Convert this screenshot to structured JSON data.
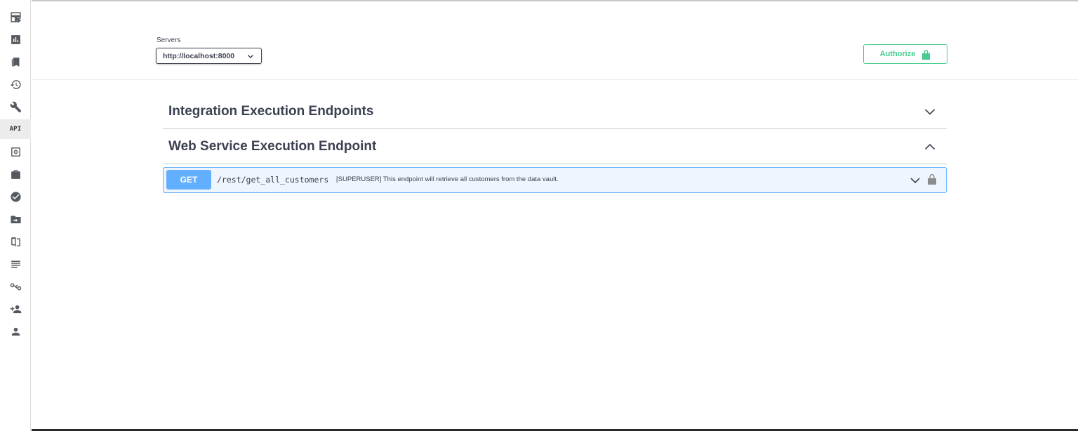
{
  "sidebar": {
    "items": [
      {
        "icon": "table-icon"
      },
      {
        "icon": "bar-chart-icon"
      },
      {
        "icon": "bookmarks-icon"
      },
      {
        "icon": "history-icon"
      },
      {
        "icon": "wrench-icon"
      },
      {
        "icon": "api-icon",
        "label": "API",
        "active": true
      },
      {
        "icon": "vault-icon"
      },
      {
        "icon": "briefcase-icon"
      },
      {
        "icon": "check-circle-icon"
      },
      {
        "icon": "folder-move-icon"
      },
      {
        "icon": "compare-icon"
      },
      {
        "icon": "list-icon"
      },
      {
        "icon": "link-icon"
      },
      {
        "icon": "add-person-icon"
      },
      {
        "icon": "person-icon"
      }
    ]
  },
  "servers": {
    "label": "Servers",
    "selected": "http://localhost:8000"
  },
  "authorize": {
    "label": "Authorize",
    "color": "#49cc90"
  },
  "tags": [
    {
      "title": "Integration Execution Endpoints",
      "expanded": false
    },
    {
      "title": "Web Service Execution Endpoint",
      "expanded": true
    }
  ],
  "operations": [
    {
      "method": "GET",
      "path": "/rest/get_all_customers",
      "summary": "[SUPERUSER] This endpoint will retrieve all customers from the data vault.",
      "color": "#61affe"
    }
  ]
}
